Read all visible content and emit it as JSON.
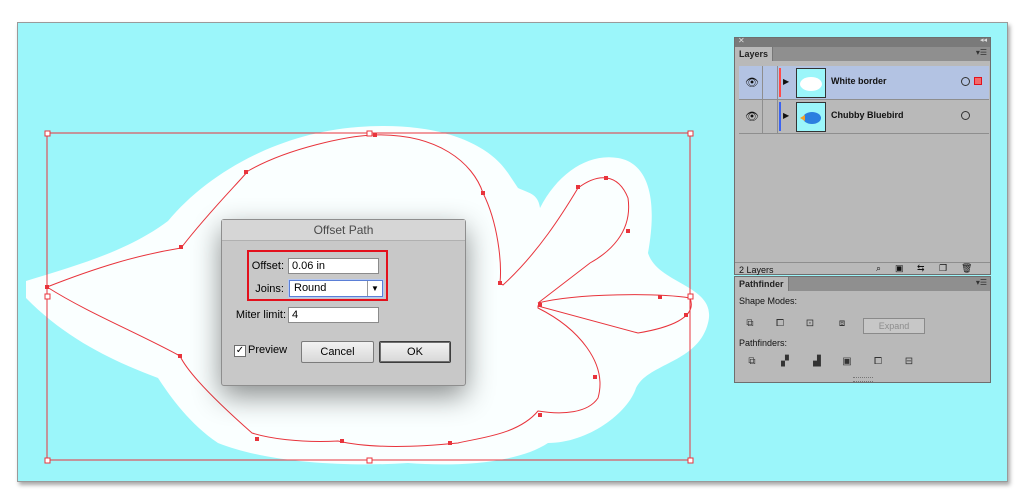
{
  "canvas": {
    "background": "#9bf6fa",
    "path_color": "#e8343c",
    "halo_color": "#ffffff"
  },
  "dialog": {
    "title": "Offset Path",
    "offset_label": "Offset:",
    "offset_value": "0.06 in",
    "joins_label": "Joins:",
    "joins_value": "Round",
    "miter_label": "Miter limit:",
    "miter_value": "4",
    "preview_label": "Preview",
    "preview_checked": true,
    "cancel_label": "Cancel",
    "ok_label": "OK"
  },
  "layers_panel": {
    "close_glyph": "✕",
    "collapse_glyph": "◂◂",
    "tab": "Layers",
    "menu_icon": "panel-menu-icon",
    "layers": [
      {
        "name": "White border",
        "color": "#ff4a4a",
        "selected": true,
        "thumb": "white-cloud-thumbnail"
      },
      {
        "name": "Chubby Bluebird",
        "color": "#3b63f0",
        "selected": false,
        "thumb": "bluebird-thumbnail"
      }
    ],
    "status": "2 Layers",
    "footer_icons": [
      "locate-icon",
      "clipping-mask-icon",
      "new-sublayer-icon",
      "new-layer-icon",
      "trash-icon"
    ]
  },
  "pathfinder_panel": {
    "tab": "Pathfinder",
    "shape_modes_label": "Shape Modes:",
    "shape_mode_icons": [
      "unite-icon",
      "minus-front-icon",
      "intersect-icon",
      "exclude-icon"
    ],
    "expand_label": "Expand",
    "pathfinders_label": "Pathfinders:",
    "pathfinder_icons": [
      "divide-icon",
      "trim-icon",
      "merge-icon",
      "crop-icon",
      "outline-icon",
      "minus-back-icon"
    ]
  }
}
